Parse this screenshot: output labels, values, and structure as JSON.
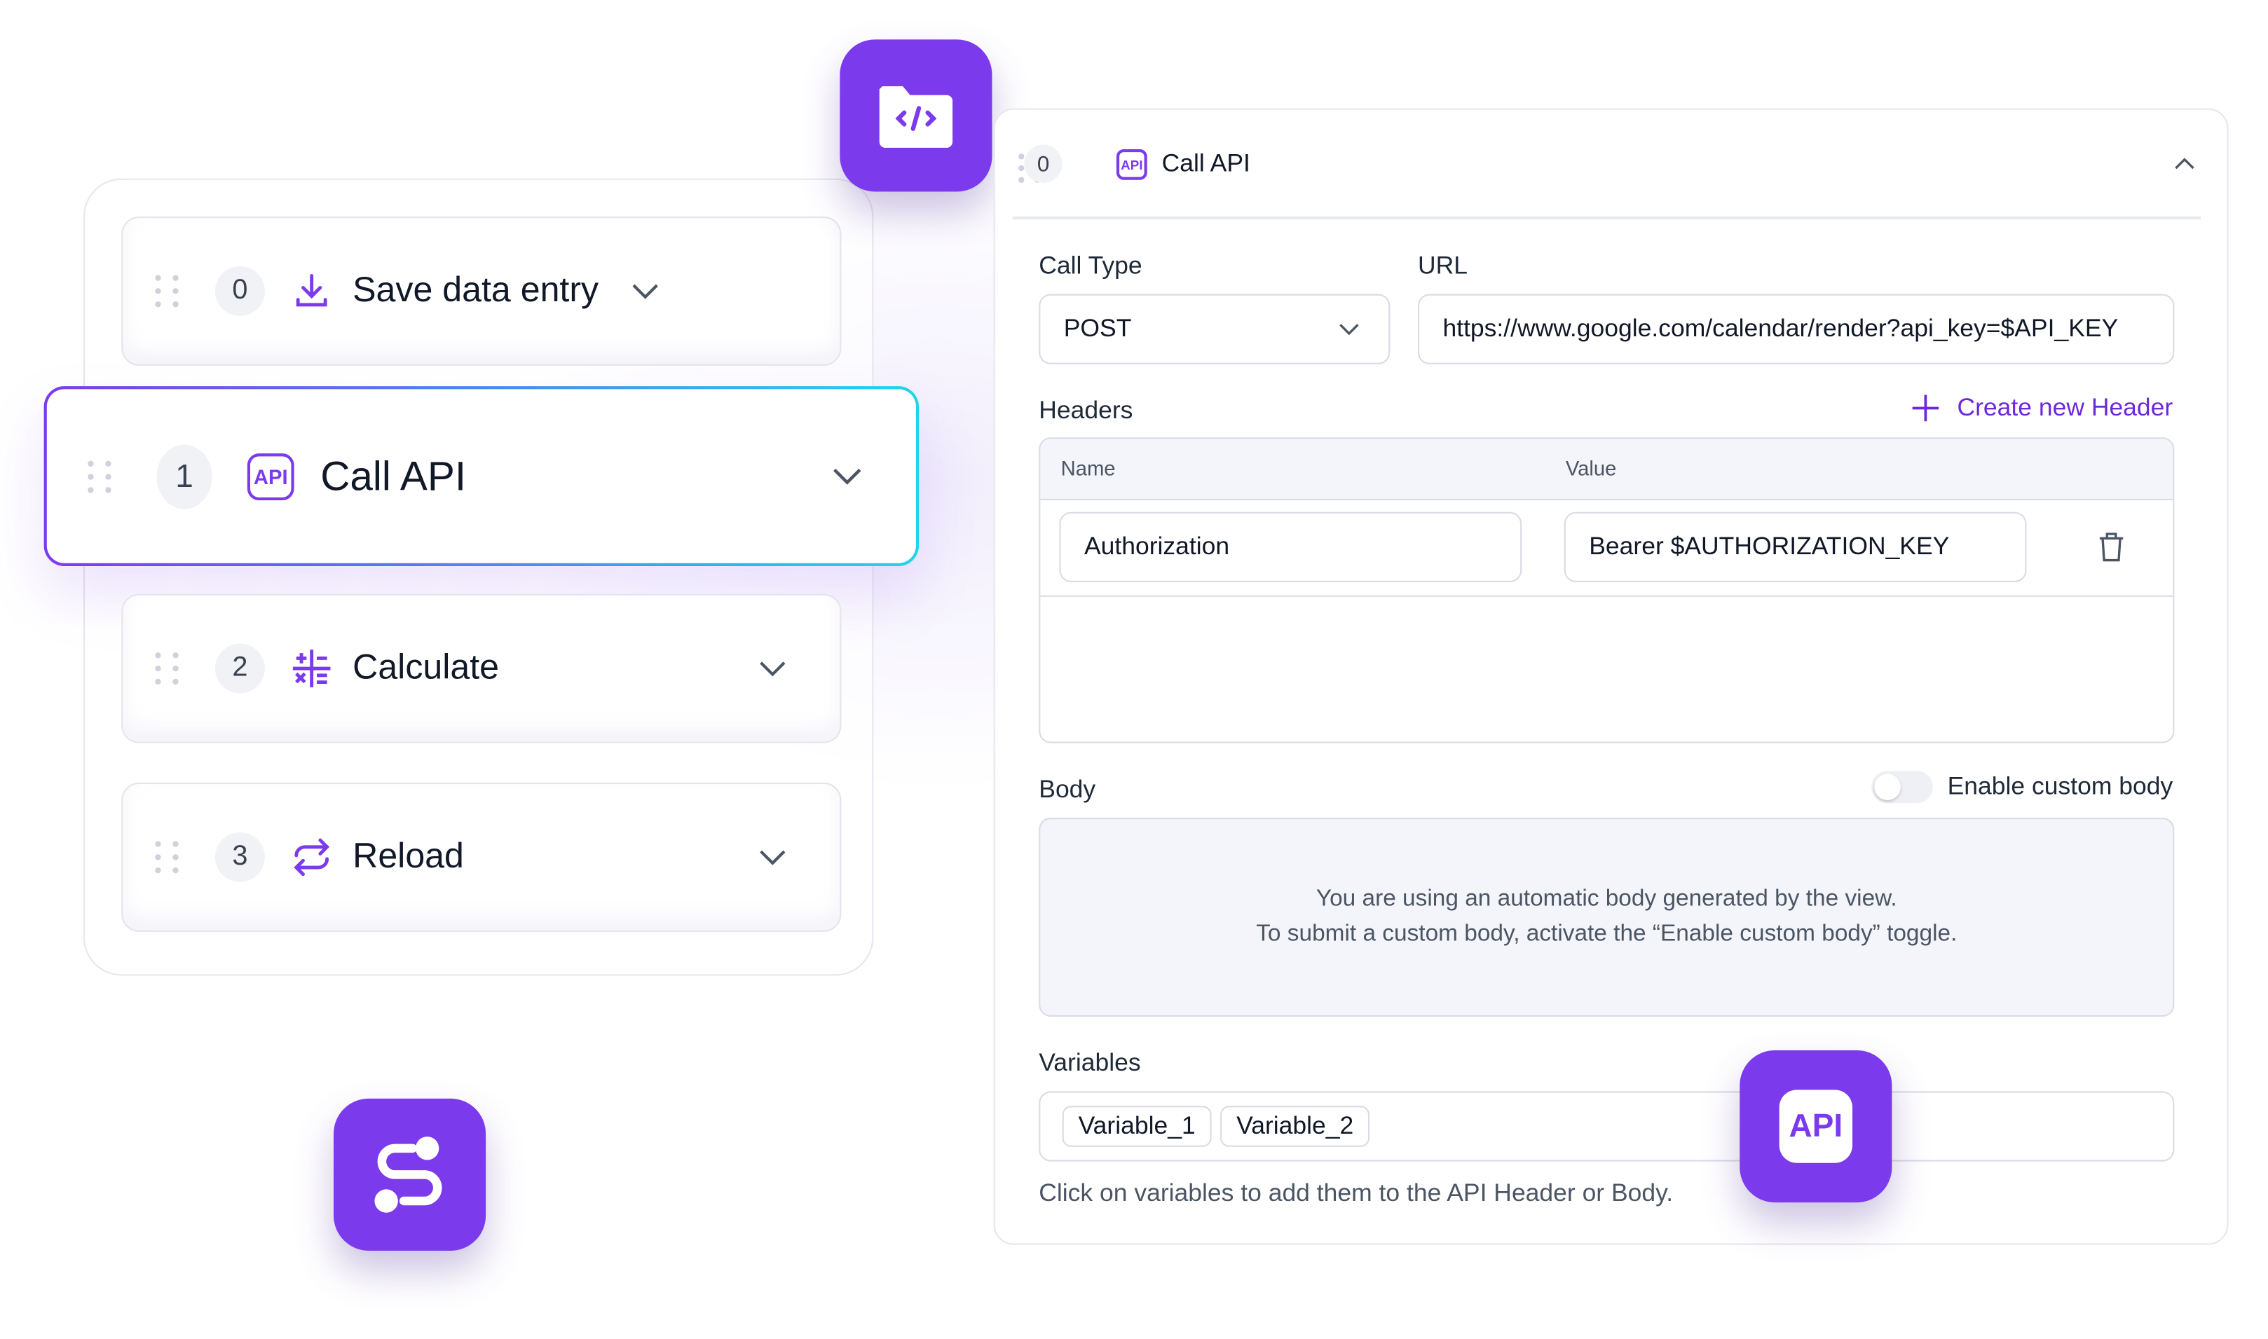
{
  "steps": [
    {
      "index": "0",
      "label": "Save data entry",
      "icon": "download-icon"
    },
    {
      "index": "1",
      "label": "Call API",
      "icon": "api-icon"
    },
    {
      "index": "2",
      "label": "Calculate",
      "icon": "calculator-icon"
    },
    {
      "index": "3",
      "label": "Reload",
      "icon": "reload-icon"
    }
  ],
  "badges": {
    "code_folder": "folder-code-icon",
    "route": "route-icon",
    "api": "API"
  },
  "panel": {
    "index": "0",
    "title": "Call API",
    "api_icon_text": "API",
    "call_type_label": "Call Type",
    "call_type_value": "POST",
    "url_label": "URL",
    "url_value": "https://www.google.com/calendar/render?api_key=$API_KEY",
    "headers_label": "Headers",
    "create_header": "Create new Header",
    "headers_cols": [
      "Name",
      "Value"
    ],
    "headers_rows": [
      {
        "name": "Authorization",
        "value": "Bearer $AUTHORIZATION_KEY"
      }
    ],
    "body_label": "Body",
    "enable_custom_body": "Enable custom body",
    "custom_body_enabled": false,
    "body_msg_1": "You are using an automatic body generated by the view.",
    "body_msg_2": "To submit a custom body, activate the “Enable custom body” toggle.",
    "variables_label": "Variables",
    "variables": [
      "Variable_1",
      "Variable_2"
    ],
    "variables_hint": "Click on variables to add them to the API Header or Body."
  },
  "colors": {
    "accent": "#7c3aed",
    "gradient_end": "#22d3ee"
  }
}
